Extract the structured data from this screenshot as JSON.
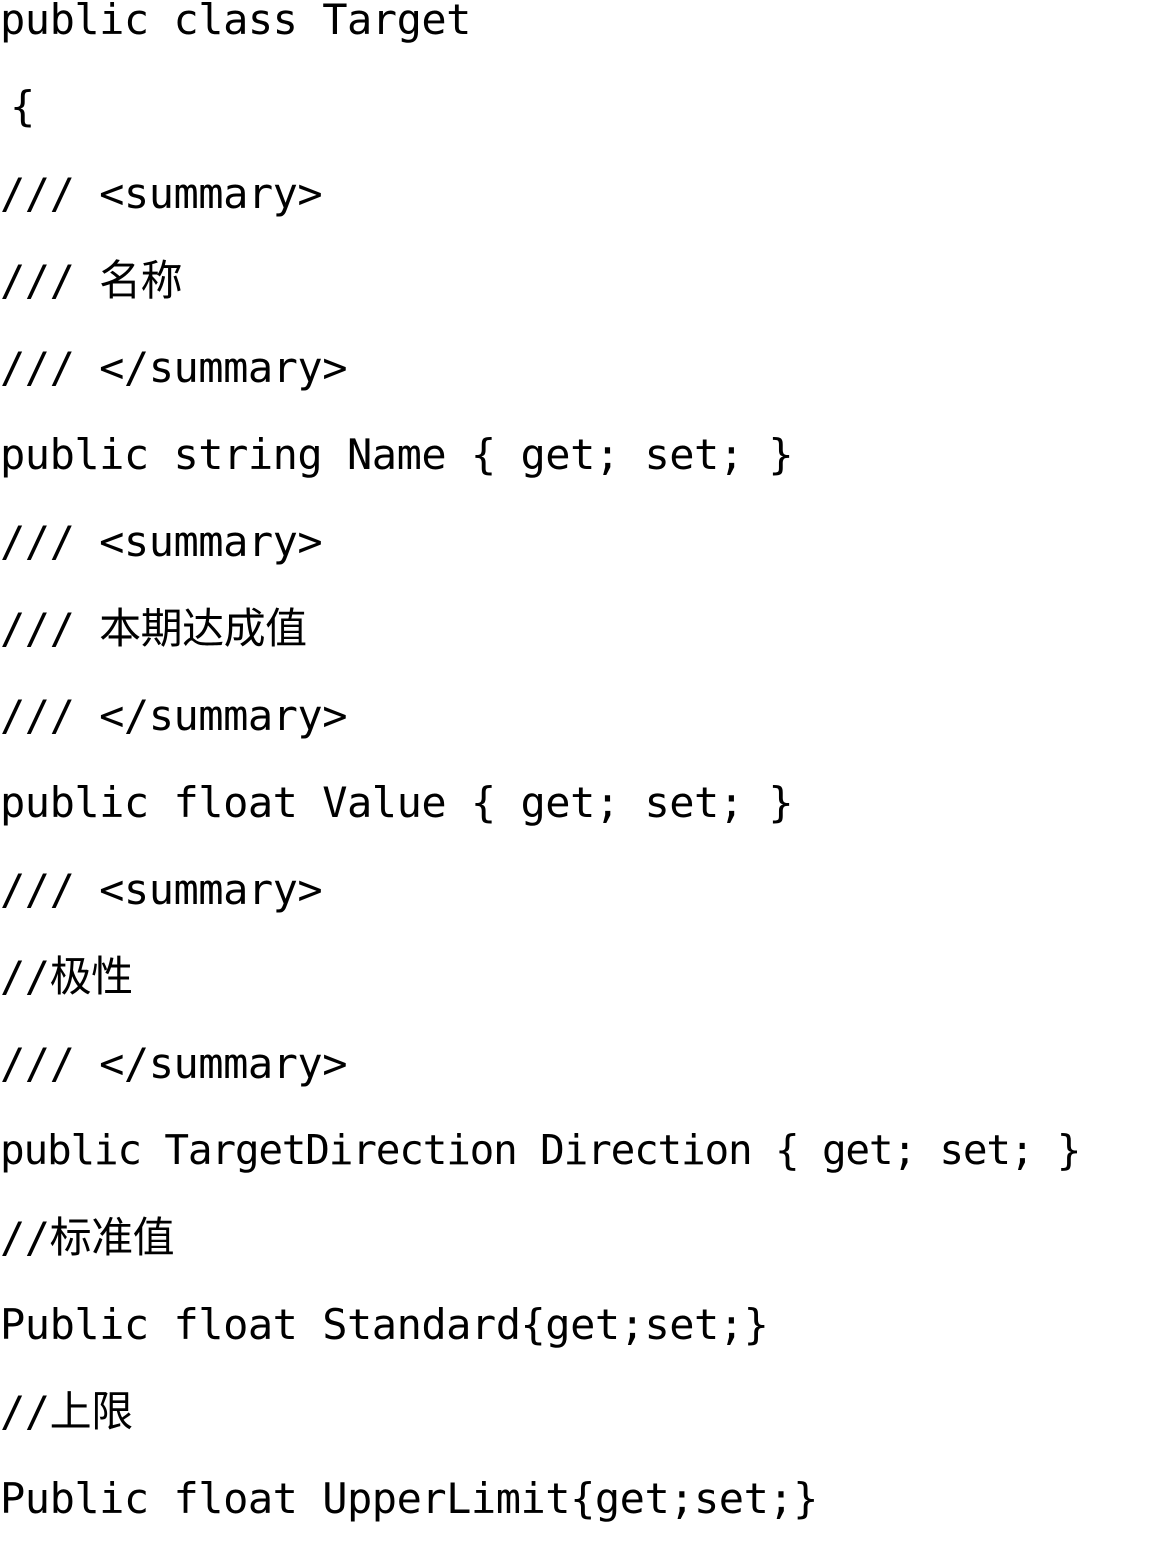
{
  "document": {
    "kind": "source-code-listing",
    "language": "C#",
    "class_name": "Target",
    "background_color": "#ffffff",
    "text_color": "#000000"
  },
  "code": {
    "lines": [
      {
        "id": "line-class-declaration",
        "text": "public class Target"
      },
      {
        "id": "line-open-brace",
        "text": "{"
      },
      {
        "id": "line-summary-open-name",
        "text": "/// <summary>"
      },
      {
        "id": "line-comment-name",
        "text": "/// 名称"
      },
      {
        "id": "line-summary-close-name",
        "text": "/// </summary>"
      },
      {
        "id": "line-property-name",
        "text": "public string Name { get; set; }"
      },
      {
        "id": "line-summary-open-value",
        "text": "/// <summary>"
      },
      {
        "id": "line-comment-value",
        "text": "/// 本期达成值"
      },
      {
        "id": "line-summary-close-value",
        "text": "/// </summary>"
      },
      {
        "id": "line-property-value",
        "text": "public float Value { get; set; }"
      },
      {
        "id": "line-summary-open-direction",
        "text": "/// <summary>"
      },
      {
        "id": "line-comment-direction",
        "text": "//极性"
      },
      {
        "id": "line-summary-close-direction",
        "text": "/// </summary>"
      },
      {
        "id": "line-property-direction",
        "text": "public TargetDirection Direction { get; set; }"
      },
      {
        "id": "line-comment-standard",
        "text": "//标准值"
      },
      {
        "id": "line-property-standard",
        "text": "Public float Standard{get;set;}"
      },
      {
        "id": "line-comment-upperlimit",
        "text": "//上限"
      },
      {
        "id": "line-property-upperlimit",
        "text": "Public float UpperLimit{get;set;}"
      }
    ]
  }
}
